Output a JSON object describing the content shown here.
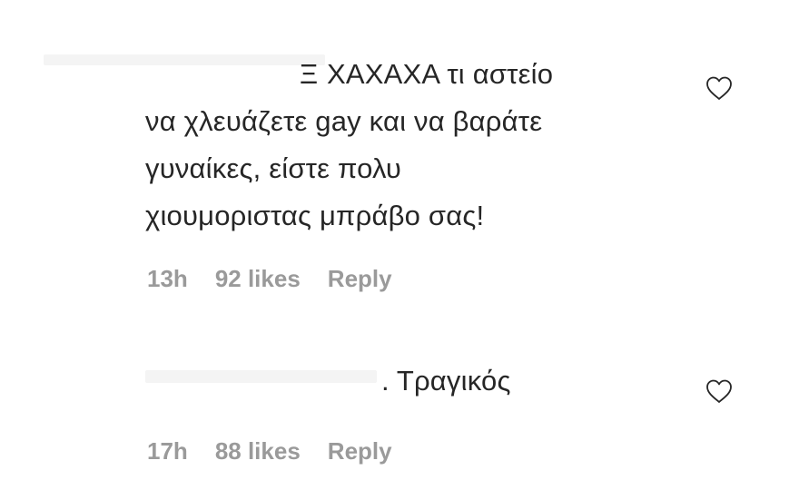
{
  "comments": [
    {
      "mark": "Ξ",
      "text_lines": [
        "ΧΑΧΑΧΑ τι αστείο",
        "να χλευάζετε gay και να βαράτε",
        "γυναίκες, είστε πολυ",
        "χιουμοριστας μπράβο σας!"
      ],
      "time": "13h",
      "likes": "92 likes",
      "reply_label": "Reply"
    },
    {
      "mark": ".",
      "text": "Τραγικός",
      "time": "17h",
      "likes": "88 likes",
      "reply_label": "Reply"
    }
  ],
  "icons": {
    "like": "heart-outline-icon"
  },
  "colors": {
    "text": "#262626",
    "meta": "#9a9a9a",
    "icon_stroke": "#262626"
  }
}
